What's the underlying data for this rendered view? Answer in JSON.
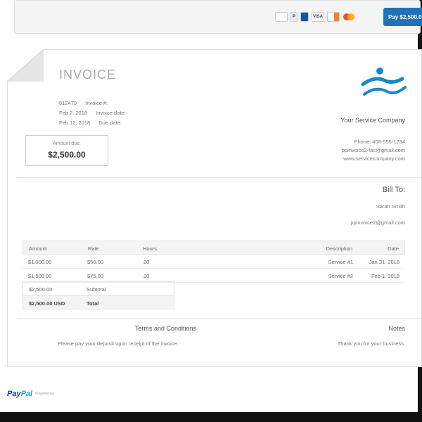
{
  "toolbar": {
    "pay_button_label": "Pay $2,500.00",
    "card_icons": [
      "credit-card-icon",
      "paypal-card-icon",
      "amex-card-icon",
      "visa-card-icon",
      "discover-card-icon",
      "mastercard-card-icon"
    ],
    "card_labels": [
      "",
      "P",
      "",
      "VISA",
      "",
      ""
    ]
  },
  "invoice": {
    "title": "INVOICE",
    "number_label": "Invoice #:",
    "number": "012479",
    "date_label": "Invoice date:",
    "date": "Feb 2, 2018",
    "due_label": "Due date:",
    "due": "Feb 12, 2018",
    "amount_due_label": "Amount due:",
    "amount_due": "$2,500.00"
  },
  "company": {
    "name": "Your Service Company",
    "phone": "Phone: 408-555-1234",
    "email": "ppinvoice2-fac@gmail.com",
    "website": "www.servicecompany.com"
  },
  "bill_to": {
    "heading": "Bill To:",
    "name": "Sarah Smith",
    "email": "ppinvoice2@gmail.com"
  },
  "table": {
    "headers": [
      "Date",
      "Description",
      "Hours",
      "Rate",
      "Amount"
    ],
    "rows": [
      [
        "Jan 31, 2018",
        "Service #1",
        "20",
        "$50.00",
        "$1,000.00"
      ],
      [
        "Feb 1, 2018",
        "Service #2",
        "20",
        "$75.00",
        "$1,500.00"
      ]
    ],
    "subtotal_label": "Subtotal",
    "subtotal": "$2,500.00",
    "total_label": "Total",
    "total": "$2,500.00 USD"
  },
  "notes": {
    "heading": "Notes",
    "text": "Thank you for your business."
  },
  "terms": {
    "heading": "Terms and Conditions",
    "text": "Please pay your deposit upon receipt of the invoice."
  },
  "footer": {
    "powered_by": "Powered by",
    "brand_pay": "Pay",
    "brand_pal": "Pal"
  },
  "colors": {
    "accent": "#1f71b8",
    "paypal_dark": "#1a3c7c",
    "paypal_light": "#1b9de2"
  }
}
